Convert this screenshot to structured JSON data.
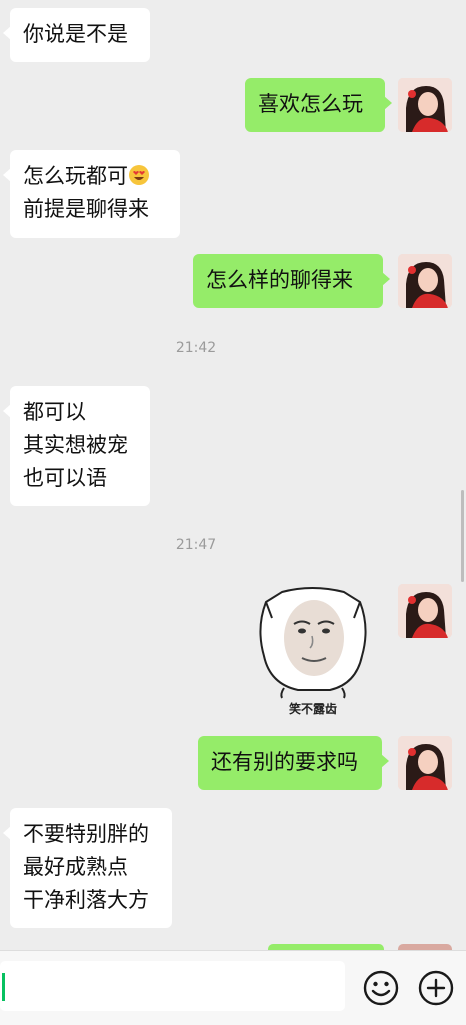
{
  "messages": {
    "m1": "你说是不是",
    "m2": "喜欢怎么玩",
    "m3_line1": "怎么玩都可",
    "m3_line2": "前提是聊得来",
    "m4": "怎么样的聊得来",
    "time1": "21:42",
    "m5_line1": "都可以",
    "m5_line2": "其实想被宠",
    "m5_line3": "也可以语",
    "time2": "21:47",
    "sticker_caption": "笑不露齿",
    "m6": "还有别的要求吗",
    "m7_line1": "不要特别胖的",
    "m7_line2": "最好成熟点",
    "m7_line3": "干净利落大方"
  },
  "colors": {
    "sent_bubble": "#95ec69",
    "received_bubble": "#ffffff",
    "background": "#ededed",
    "cursor": "#07c160"
  },
  "icons": [
    "smiling-face-with-heart-eyes-emoji",
    "emoji-button-icon",
    "plus-button-icon"
  ]
}
